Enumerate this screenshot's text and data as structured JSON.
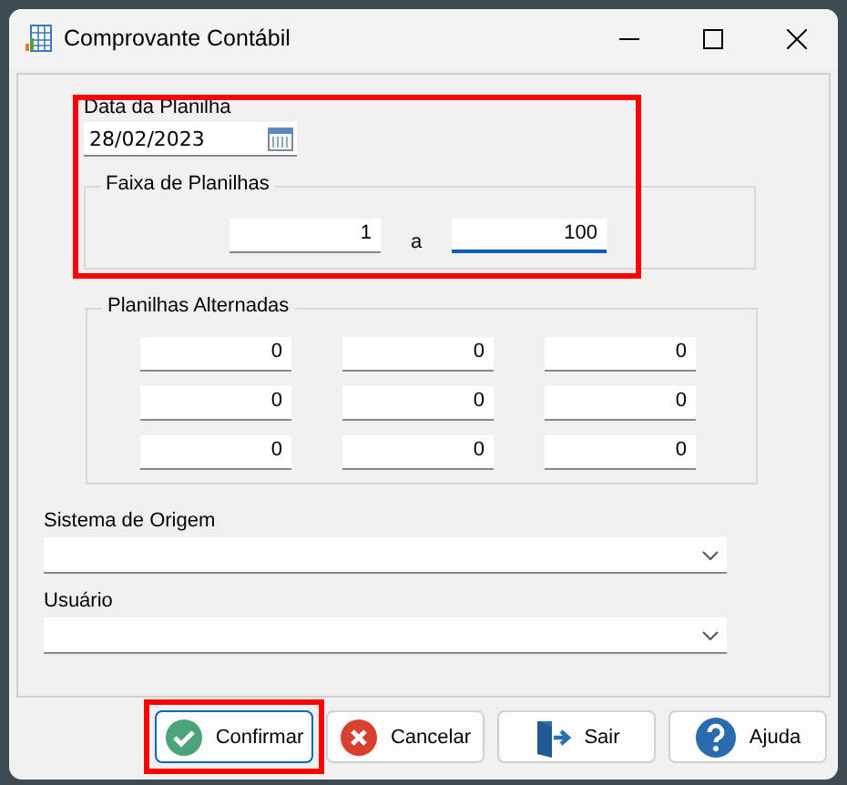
{
  "window": {
    "title": "Comprovante Contábil"
  },
  "period": {
    "highlighted": true,
    "date_field": {
      "label": "Data da Planilha",
      "value": "28/02/2023"
    },
    "range_group": {
      "title": "Faixa de Planilhas",
      "from": "1",
      "separator": "a",
      "to": "100"
    }
  },
  "alternate_group": {
    "title": "Planilhas Alternadas",
    "rows": [
      [
        "0",
        "0",
        "0"
      ],
      [
        "0",
        "0",
        "0"
      ],
      [
        "0",
        "0",
        "0"
      ]
    ]
  },
  "combos": [
    {
      "label": "Sistema de Origem"
    },
    {
      "label": "Usuário"
    }
  ],
  "buttons": [
    {
      "label": "Confirmar",
      "kind": "confirm",
      "highlighted": true
    },
    {
      "label": "Cancelar",
      "kind": "cancel",
      "highlighted": false
    },
    {
      "label": "Sair",
      "kind": "exit",
      "highlighted": false
    },
    {
      "label": "Ajuda",
      "kind": "help",
      "highlighted": false
    }
  ]
}
